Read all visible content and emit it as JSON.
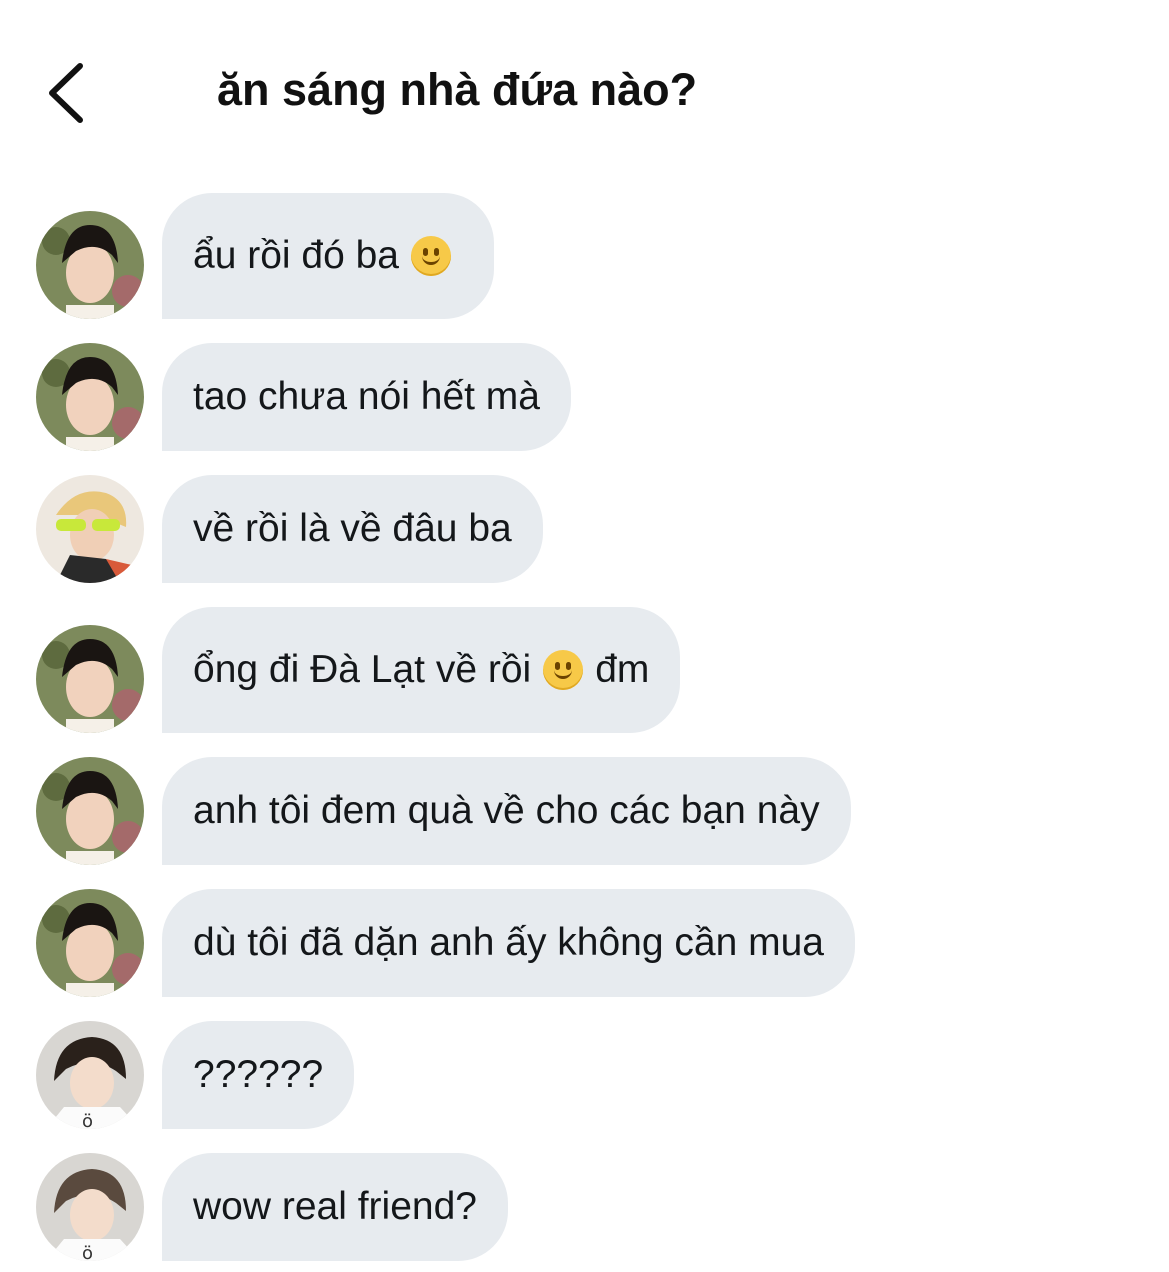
{
  "header": {
    "title": "ăn sáng nhà đứa nào?"
  },
  "colors": {
    "bubble": "#e7ebef",
    "text": "#14171a",
    "emoji": "#f7c948"
  },
  "messages": [
    {
      "avatar": "avatar-dark-hair",
      "parts": [
        "ẩu rồi đó ba",
        "emoji:slightly-smiling-face"
      ]
    },
    {
      "avatar": "avatar-dark-hair",
      "parts": [
        "tao chưa nói hết mà"
      ]
    },
    {
      "avatar": "avatar-yellow-glasses",
      "parts": [
        "về rồi là về đâu ba"
      ]
    },
    {
      "avatar": "avatar-dark-hair",
      "parts": [
        "ổng đi Đà Lạt về rồi",
        "emoji:slightly-smiling-face",
        "đm"
      ]
    },
    {
      "avatar": "avatar-dark-hair",
      "parts": [
        "anh tôi đem quà về cho các bạn này"
      ]
    },
    {
      "avatar": "avatar-dark-hair",
      "parts": [
        "dù tôi đã dặn anh ấy không cần mua"
      ]
    },
    {
      "avatar": "avatar-light-shirt",
      "parts": [
        "??????"
      ]
    },
    {
      "avatar": "avatar-light-shirt",
      "parts": [
        "wow real friend?"
      ]
    }
  ]
}
